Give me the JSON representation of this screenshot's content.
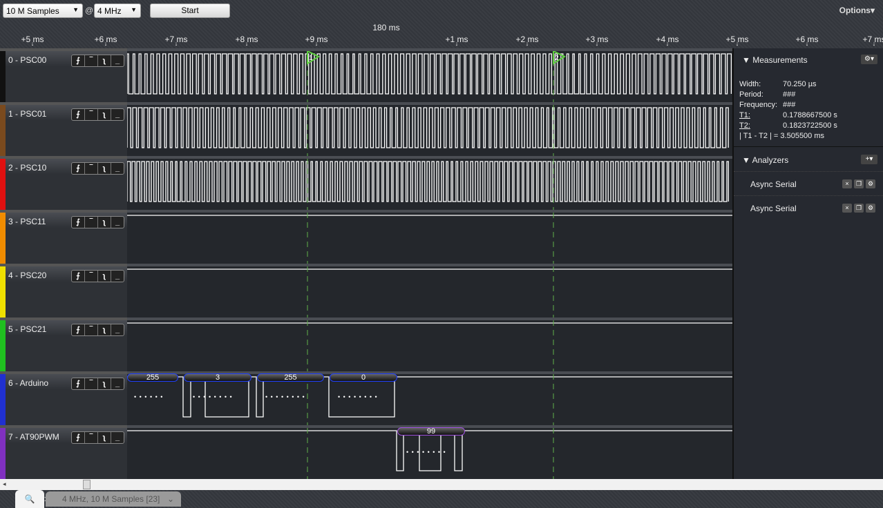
{
  "toolbar": {
    "samples": "10 M Samples",
    "at": "@",
    "rate": "4 MHz",
    "start": "Start",
    "options": "Options▾"
  },
  "ruler": {
    "center": "180 ms",
    "ticks": [
      "+5 ms",
      "+6 ms",
      "+7 ms",
      "+8 ms",
      "+9 ms",
      "+1 ms",
      "+2 ms",
      "+3 ms",
      "+4 ms",
      "+5 ms",
      "+6 ms",
      "+7 ms"
    ]
  },
  "markers": [
    {
      "label": "1"
    },
    {
      "label": "2"
    }
  ],
  "channels": [
    {
      "name": "0 - PSC00",
      "color": "#111111"
    },
    {
      "name": "1 - PSC01",
      "color": "#7a4a1e"
    },
    {
      "name": "2 - PSC10",
      "color": "#e01010"
    },
    {
      "name": "3 - PSC11",
      "color": "#f08c00"
    },
    {
      "name": "4 - PSC20",
      "color": "#f0e000"
    },
    {
      "name": "5 - PSC21",
      "color": "#20c020"
    },
    {
      "name": "6 - Arduino",
      "color": "#2030d0"
    },
    {
      "name": "7 - AT90PWM",
      "color": "#8030c0"
    }
  ],
  "trigger_buttons": [
    "⨍",
    "‾",
    "ʅ",
    "_"
  ],
  "decoded": {
    "arduino": [
      "255",
      "3",
      "255",
      "0"
    ],
    "at90pwm": [
      "99"
    ],
    "dots": "• • • • • • • •"
  },
  "measurements": {
    "title": "Measurements",
    "gear": "⚙▾",
    "rows": [
      {
        "label": "Width:",
        "value": "70.250 µs"
      },
      {
        "label": "Period:",
        "value": "###"
      },
      {
        "label": "Frequency:",
        "value": "###"
      },
      {
        "label": "T1:",
        "value": "0.1788667500 s"
      },
      {
        "label": "T2:",
        "value": "0.1823722500 s"
      }
    ],
    "diff": "| T1 - T2 | = 3.505500 ms"
  },
  "analyzers": {
    "title": "Analyzers",
    "add": "+▾",
    "items": [
      {
        "label": "Async Serial"
      },
      {
        "label": "Async Serial"
      }
    ],
    "icons": [
      "×",
      "❐",
      "⚙"
    ]
  },
  "tabs": {
    "search": "🔍",
    "arrow": ">",
    "session": "4 MHz, 10 M Samples [23]",
    "chevron": "⌄"
  }
}
